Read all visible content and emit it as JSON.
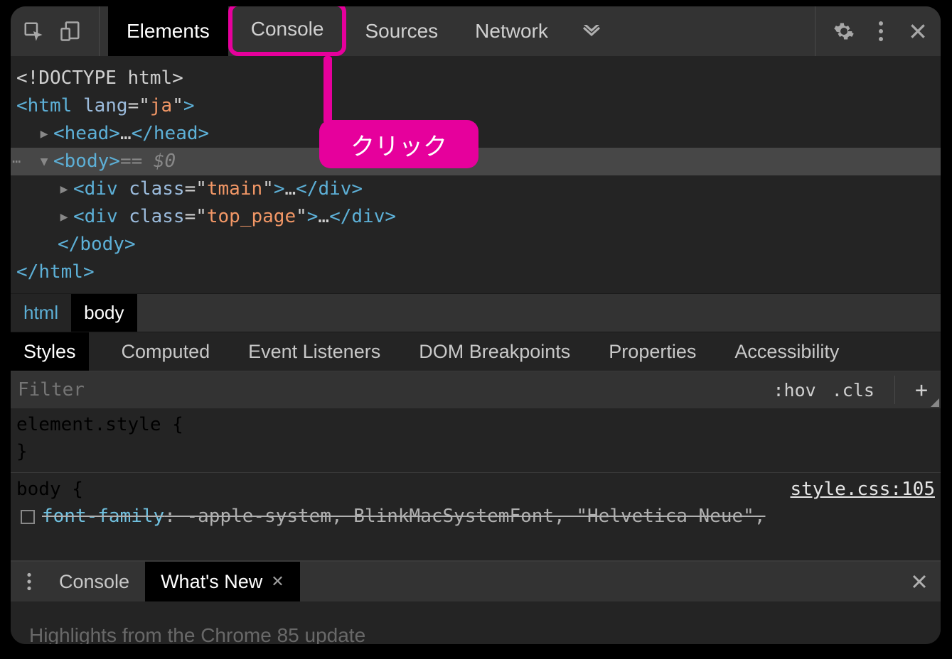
{
  "toolbar": {
    "tabs": [
      "Elements",
      "Console",
      "Sources",
      "Network"
    ],
    "active_tab_index": 0,
    "highlighted_tab_index": 1
  },
  "annotation": {
    "label": "クリック"
  },
  "dom_tree": {
    "doctype": "<!DOCTYPE html>",
    "html_open_tag": "html",
    "html_attr_name": "lang",
    "html_attr_val": "ja",
    "head_tag": "head",
    "head_ellipsis": "…",
    "body_tag": "body",
    "body_marker": " == $0",
    "div1_tag": "div",
    "div1_class": "tmain",
    "div1_ellipsis": "…",
    "div2_tag": "div",
    "div2_class": "top_page",
    "div2_ellipsis": "…",
    "attr_class": "class"
  },
  "breadcrumb": {
    "items": [
      "html",
      "body"
    ]
  },
  "subtabs": {
    "items": [
      "Styles",
      "Computed",
      "Event Listeners",
      "DOM Breakpoints",
      "Properties",
      "Accessibility"
    ],
    "active_index": 0
  },
  "filterbar": {
    "placeholder": "Filter",
    "hov": ":hov",
    "cls": ".cls"
  },
  "styles": {
    "element_style_selector": "element.style {",
    "element_style_close": "}",
    "body_selector": "body {",
    "body_source": "style.css:105",
    "font_family_prop": "font-family",
    "font_family_value": ": -apple-system, BlinkMacSystemFont, \"Helvetica Neue\","
  },
  "drawer": {
    "tabs": [
      "Console",
      "What's New"
    ],
    "active_index": 1,
    "content_preview": "Highlights from the Chrome 85 update"
  }
}
